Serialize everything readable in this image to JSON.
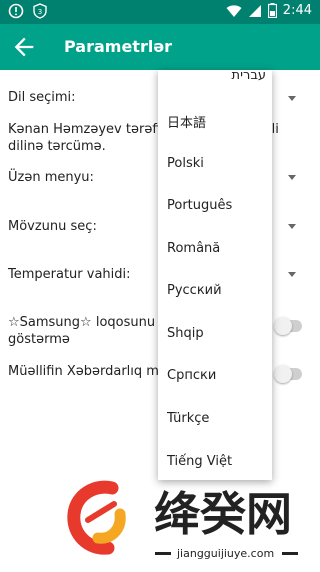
{
  "status_bar": {
    "time": "2:44",
    "left_icons": [
      "alert-circle-icon",
      "shield-icon"
    ],
    "right_icons": [
      "wifi-icon",
      "signal-icon",
      "battery-icon"
    ]
  },
  "app_bar": {
    "title": "Parametrlər",
    "back_icon": "arrow-back-icon"
  },
  "settings": {
    "language_label": "Dil seçimi:",
    "translation_text_line1": "Kənan Həmzəyev tərəfin",
    "translation_text_line1_right": "Dili",
    "translation_text_line2": "dilinə tərcümə.",
    "floating_menu_label": "Üzən menyu:",
    "theme_label": "Mövzunu seç:",
    "temperature_label": "Temperatur vahidi:",
    "samsung_label_line1": "☆Samsung☆ loqosunu",
    "samsung_label_line2": "göstərmə",
    "author_warning_label": "Müəllifin Xəbərdarlıq  m"
  },
  "dropdown": {
    "options": [
      "עברית",
      "日本語",
      "Polski",
      "Português",
      "Română",
      "Русский",
      "Shqip",
      "Српски",
      "Türkçe",
      "Tiếng Việt"
    ]
  },
  "watermark": {
    "text": "绛癸网",
    "url": "jiangguijiuye.com",
    "colors": {
      "red": "#e83a2c",
      "orange": "#f5a623"
    }
  }
}
